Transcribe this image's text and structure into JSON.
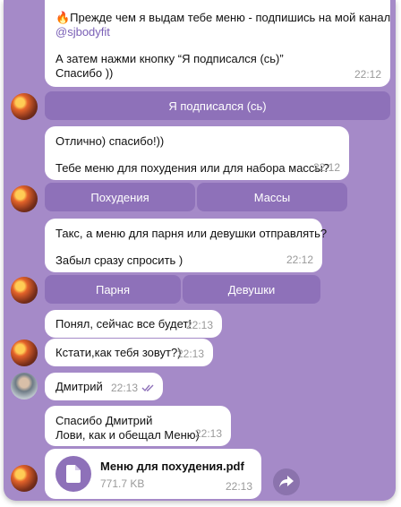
{
  "messages": {
    "m1": {
      "line1": "🔥Прежде чем я выдам тебе меню - подпишись на мой канал",
      "line2": "@sjbodyfit",
      "line3": "А затем нажми кнопку “Я подписался (сь)”",
      "line4": "Спасибо ))",
      "time": "22:12"
    },
    "m2": {
      "line1": "Отлично) спасибо!))",
      "line2": "Тебе меню для похудения или для набора массы?",
      "time": "22:12"
    },
    "m3": {
      "line1": "Такс, а меню для парня или девушки отправлять?",
      "line2": "Забыл сразу спросить )",
      "time": "22:12"
    },
    "m4": {
      "text": "Понял, сейчас все будет!",
      "time": "22:13"
    },
    "m5": {
      "text": "Кстати,как тебя зовут?)",
      "time": "22:13"
    },
    "m6": {
      "text": "Дмитрий",
      "time": "22:13"
    },
    "m7": {
      "line1": "Спасибо Дмитрий",
      "line2": "Лови, как и обещал Меню)",
      "time": "22:13"
    },
    "m8": {
      "file_name": "Меню для похудения.pdf",
      "file_size": "771.7 KB",
      "time": "22:13"
    }
  },
  "buttons": {
    "subscribed": "Я подписался (сь)",
    "lose_weight": "Похудения",
    "mass": "Массы",
    "guy": "Парня",
    "girl": "Девушки"
  },
  "colors": {
    "chat_background": "#a58ac8",
    "inline_button": "#8e71b9",
    "bubble": "#ffffff",
    "link": "#7a5fb6"
  },
  "icons": {
    "read_status": "double-check-icon",
    "document": "document-icon",
    "share": "share-icon"
  }
}
